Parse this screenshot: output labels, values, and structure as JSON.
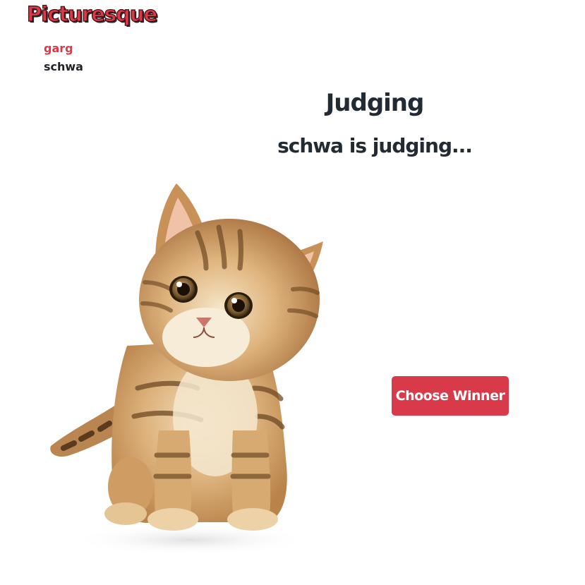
{
  "app": {
    "logo_text": "Picturesque"
  },
  "players": [
    {
      "name": "garg",
      "active": true
    },
    {
      "name": "schwa",
      "active": false
    }
  ],
  "main": {
    "title": "Judging",
    "subtitle": "schwa is judging...",
    "choose_winner_label": "Choose Winner"
  },
  "colors": {
    "accent": "#d83a4a",
    "text": "#222a33",
    "background": "#ffffff"
  }
}
